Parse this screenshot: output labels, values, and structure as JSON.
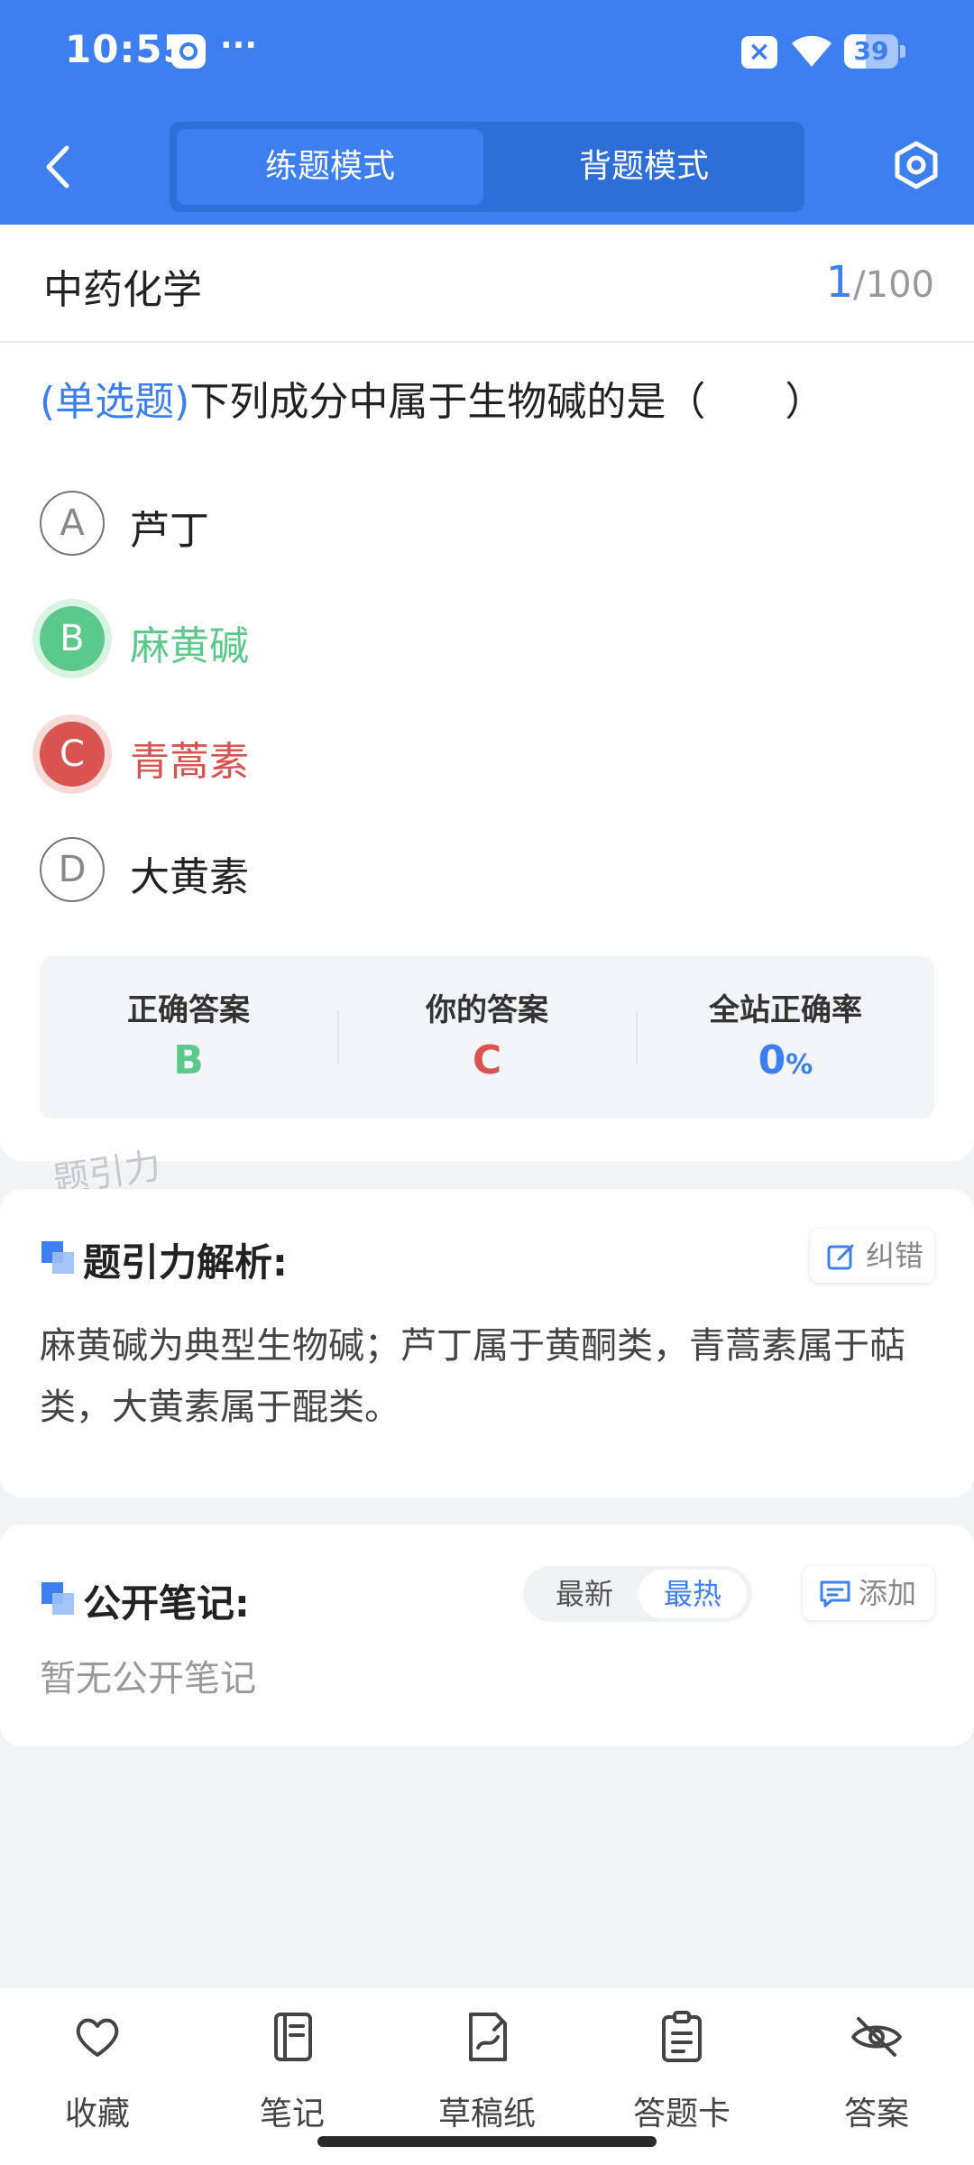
{
  "status_bar": {
    "time": "10:55",
    "dots": "···",
    "battery_level": "39"
  },
  "header": {
    "tabs": [
      {
        "label": "练题模式",
        "active": true
      },
      {
        "label": "背题模式",
        "active": false
      }
    ],
    "back_icon": "chevron-left-icon",
    "settings_icon": "hexagon-settings-icon"
  },
  "question_card": {
    "subject": "中药化学",
    "progress_current": "1",
    "progress_total": "/100",
    "question_type": "(单选题)",
    "question_text": "下列成分中属于生物碱的是（　　）",
    "options": [
      {
        "key": "A",
        "text": "芦丁",
        "state": "normal"
      },
      {
        "key": "B",
        "text": "麻黄碱",
        "state": "correct"
      },
      {
        "key": "C",
        "text": "青蒿素",
        "state": "wrong"
      },
      {
        "key": "D",
        "text": "大黄素",
        "state": "normal"
      }
    ],
    "answer_summary": {
      "correct_label": "正确答案",
      "correct_value": "B",
      "yours_label": "你的答案",
      "yours_value": "C",
      "rate_label": "全站正确率",
      "rate_value": "0",
      "rate_unit": "%"
    },
    "colors": {
      "accent": "#3d7ff0",
      "correct": "#5ac98a",
      "wrong": "#d9534f"
    }
  },
  "watermark": "题引力",
  "analysis": {
    "title": "题引力解析:",
    "report_button": "纠错",
    "text": "麻黄碱为典型生物碱；芦丁属于黄酮类，青蒿素属于萜类，大黄素属于醌类。"
  },
  "notes": {
    "title": "公开笔记:",
    "sort_options": [
      "最新",
      "最热"
    ],
    "sort_selected": "最热",
    "add_button": "添加",
    "empty_text": "暂无公开笔记"
  },
  "bottom_bar": {
    "items": [
      {
        "label": "收藏",
        "icon": "heart-icon"
      },
      {
        "label": "笔记",
        "icon": "notebook-icon"
      },
      {
        "label": "草稿纸",
        "icon": "draft-paper-icon"
      },
      {
        "label": "答题卡",
        "icon": "answer-sheet-icon"
      },
      {
        "label": "答案",
        "icon": "eye-off-icon"
      }
    ]
  }
}
